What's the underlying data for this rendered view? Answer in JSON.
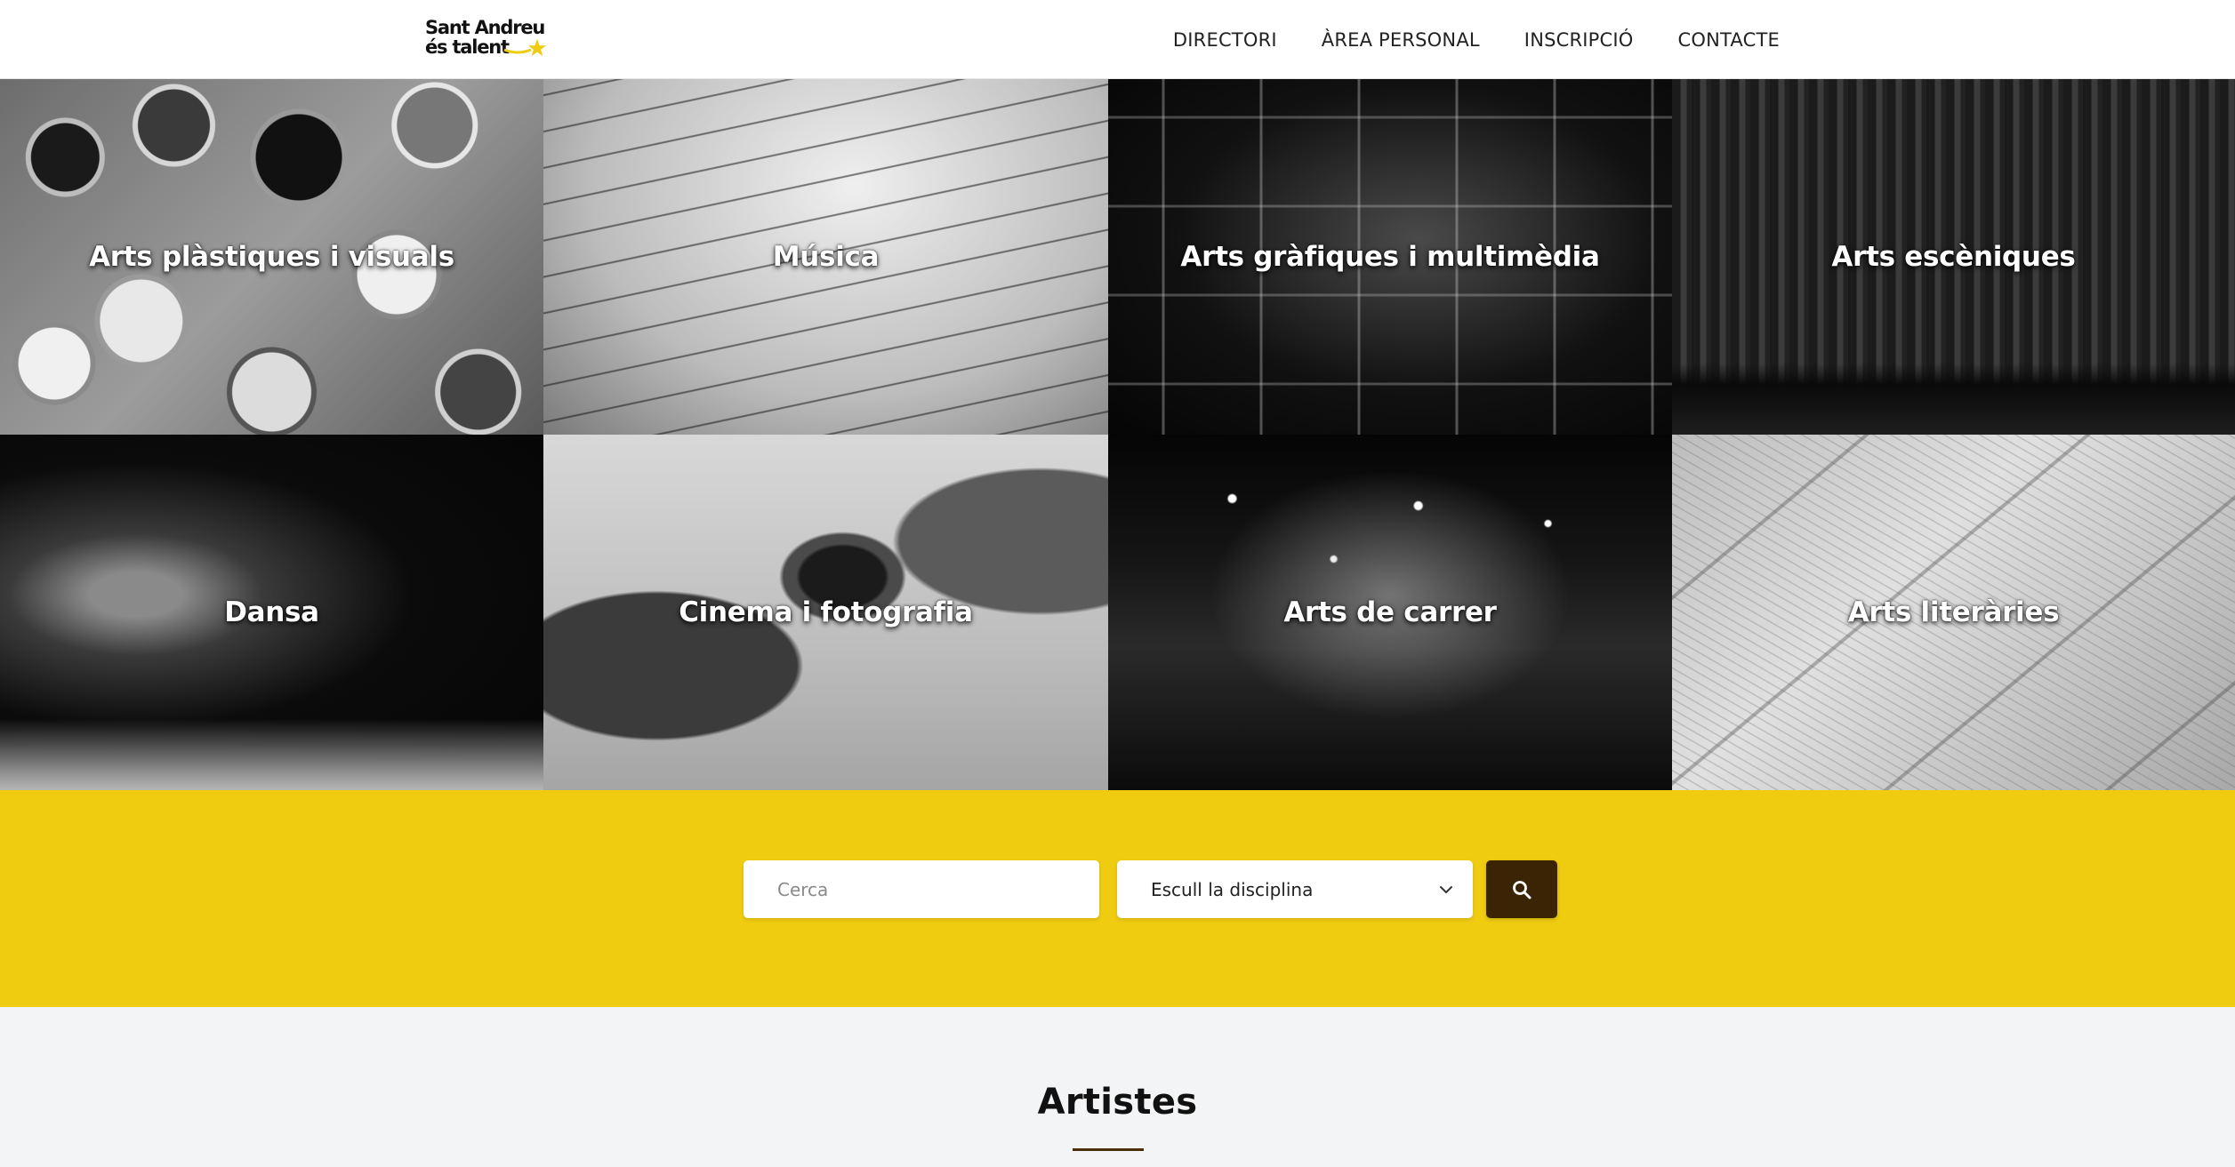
{
  "brand": {
    "name_line1": "Sant Andreu",
    "name_line2": "és talent",
    "accent_color": "#efcc10",
    "dark_color": "#3b2406"
  },
  "nav": {
    "items": [
      {
        "label": "DIRECTORI"
      },
      {
        "label": "ÀREA PERSONAL"
      },
      {
        "label": "INSCRIPCIÓ"
      },
      {
        "label": "CONTACTE"
      }
    ]
  },
  "categories": [
    {
      "label": "Arts plàstiques i visuals"
    },
    {
      "label": "Música"
    },
    {
      "label": "Arts gràfiques i multimèdia"
    },
    {
      "label": "Arts escèniques"
    },
    {
      "label": "Dansa"
    },
    {
      "label": "Cinema i fotografia"
    },
    {
      "label": "Arts de carrer"
    },
    {
      "label": "Arts literàries"
    }
  ],
  "search": {
    "placeholder": "Cerca",
    "value": "",
    "discipline_selected": "Escull la disciplina",
    "button_icon": "search-icon"
  },
  "artists": {
    "title": "Artistes"
  }
}
